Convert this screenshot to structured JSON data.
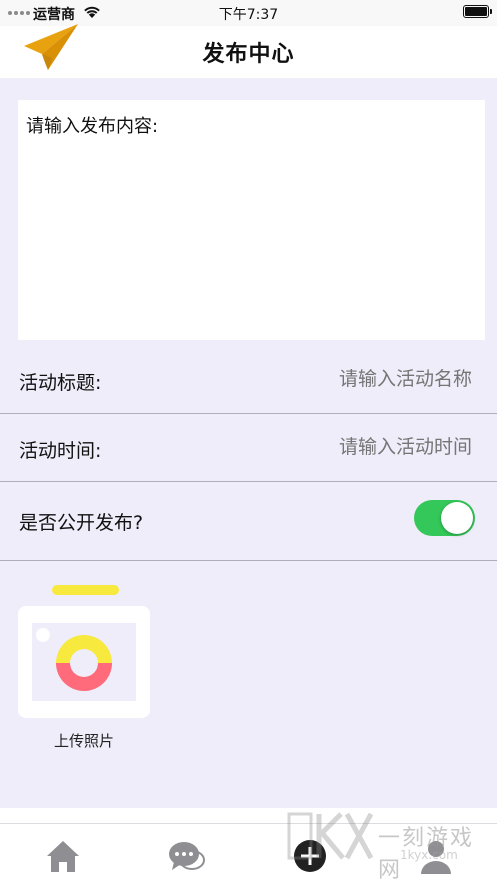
{
  "status_bar": {
    "carrier": "运营商",
    "time": "下午7:37"
  },
  "nav": {
    "title": "发布中心",
    "logo_icon": "paper-plane-icon"
  },
  "content": {
    "placeholder": "请输入发布内容:"
  },
  "form": {
    "title_label": "活动标题:",
    "title_placeholder": "请输入活动名称",
    "time_label": "活动时间:",
    "time_placeholder": "请输入活动时间",
    "public_label": "是否公开发布?",
    "public_enabled": true
  },
  "upload": {
    "label": "上传照片",
    "icon": "camera-icon"
  },
  "tabbar": {
    "tabs": [
      {
        "icon": "home-icon"
      },
      {
        "icon": "chat-icon"
      },
      {
        "icon": "add-icon"
      },
      {
        "icon": "profile-icon"
      }
    ]
  },
  "watermark": {
    "text": "一刻游戏网",
    "url": "1kyx.com"
  },
  "colors": {
    "page_bg": "#efedf9",
    "toggle_on": "#34c759",
    "plane": "#e9a20f",
    "camera_yellow": "#f7e93d",
    "camera_pink": "#ff6b7a"
  }
}
